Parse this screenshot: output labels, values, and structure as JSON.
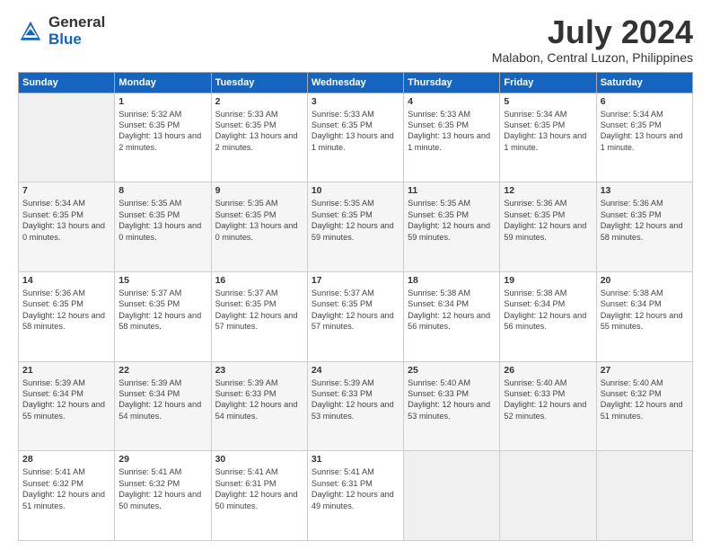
{
  "logo": {
    "text_general": "General",
    "text_blue": "Blue"
  },
  "header": {
    "title": "July 2024",
    "subtitle": "Malabon, Central Luzon, Philippines"
  },
  "days_of_week": [
    "Sunday",
    "Monday",
    "Tuesday",
    "Wednesday",
    "Thursday",
    "Friday",
    "Saturday"
  ],
  "weeks": [
    [
      {
        "day": "",
        "empty": true
      },
      {
        "day": "1",
        "sunrise": "Sunrise: 5:32 AM",
        "sunset": "Sunset: 6:35 PM",
        "daylight": "Daylight: 13 hours and 2 minutes."
      },
      {
        "day": "2",
        "sunrise": "Sunrise: 5:33 AM",
        "sunset": "Sunset: 6:35 PM",
        "daylight": "Daylight: 13 hours and 2 minutes."
      },
      {
        "day": "3",
        "sunrise": "Sunrise: 5:33 AM",
        "sunset": "Sunset: 6:35 PM",
        "daylight": "Daylight: 13 hours and 1 minute."
      },
      {
        "day": "4",
        "sunrise": "Sunrise: 5:33 AM",
        "sunset": "Sunset: 6:35 PM",
        "daylight": "Daylight: 13 hours and 1 minute."
      },
      {
        "day": "5",
        "sunrise": "Sunrise: 5:34 AM",
        "sunset": "Sunset: 6:35 PM",
        "daylight": "Daylight: 13 hours and 1 minute."
      },
      {
        "day": "6",
        "sunrise": "Sunrise: 5:34 AM",
        "sunset": "Sunset: 6:35 PM",
        "daylight": "Daylight: 13 hours and 1 minute."
      }
    ],
    [
      {
        "day": "7",
        "sunrise": "Sunrise: 5:34 AM",
        "sunset": "Sunset: 6:35 PM",
        "daylight": "Daylight: 13 hours and 0 minutes."
      },
      {
        "day": "8",
        "sunrise": "Sunrise: 5:35 AM",
        "sunset": "Sunset: 6:35 PM",
        "daylight": "Daylight: 13 hours and 0 minutes."
      },
      {
        "day": "9",
        "sunrise": "Sunrise: 5:35 AM",
        "sunset": "Sunset: 6:35 PM",
        "daylight": "Daylight: 13 hours and 0 minutes."
      },
      {
        "day": "10",
        "sunrise": "Sunrise: 5:35 AM",
        "sunset": "Sunset: 6:35 PM",
        "daylight": "Daylight: 12 hours and 59 minutes."
      },
      {
        "day": "11",
        "sunrise": "Sunrise: 5:35 AM",
        "sunset": "Sunset: 6:35 PM",
        "daylight": "Daylight: 12 hours and 59 minutes."
      },
      {
        "day": "12",
        "sunrise": "Sunrise: 5:36 AM",
        "sunset": "Sunset: 6:35 PM",
        "daylight": "Daylight: 12 hours and 59 minutes."
      },
      {
        "day": "13",
        "sunrise": "Sunrise: 5:36 AM",
        "sunset": "Sunset: 6:35 PM",
        "daylight": "Daylight: 12 hours and 58 minutes."
      }
    ],
    [
      {
        "day": "14",
        "sunrise": "Sunrise: 5:36 AM",
        "sunset": "Sunset: 6:35 PM",
        "daylight": "Daylight: 12 hours and 58 minutes."
      },
      {
        "day": "15",
        "sunrise": "Sunrise: 5:37 AM",
        "sunset": "Sunset: 6:35 PM",
        "daylight": "Daylight: 12 hours and 58 minutes."
      },
      {
        "day": "16",
        "sunrise": "Sunrise: 5:37 AM",
        "sunset": "Sunset: 6:35 PM",
        "daylight": "Daylight: 12 hours and 57 minutes."
      },
      {
        "day": "17",
        "sunrise": "Sunrise: 5:37 AM",
        "sunset": "Sunset: 6:35 PM",
        "daylight": "Daylight: 12 hours and 57 minutes."
      },
      {
        "day": "18",
        "sunrise": "Sunrise: 5:38 AM",
        "sunset": "Sunset: 6:34 PM",
        "daylight": "Daylight: 12 hours and 56 minutes."
      },
      {
        "day": "19",
        "sunrise": "Sunrise: 5:38 AM",
        "sunset": "Sunset: 6:34 PM",
        "daylight": "Daylight: 12 hours and 56 minutes."
      },
      {
        "day": "20",
        "sunrise": "Sunrise: 5:38 AM",
        "sunset": "Sunset: 6:34 PM",
        "daylight": "Daylight: 12 hours and 55 minutes."
      }
    ],
    [
      {
        "day": "21",
        "sunrise": "Sunrise: 5:39 AM",
        "sunset": "Sunset: 6:34 PM",
        "daylight": "Daylight: 12 hours and 55 minutes."
      },
      {
        "day": "22",
        "sunrise": "Sunrise: 5:39 AM",
        "sunset": "Sunset: 6:34 PM",
        "daylight": "Daylight: 12 hours and 54 minutes."
      },
      {
        "day": "23",
        "sunrise": "Sunrise: 5:39 AM",
        "sunset": "Sunset: 6:33 PM",
        "daylight": "Daylight: 12 hours and 54 minutes."
      },
      {
        "day": "24",
        "sunrise": "Sunrise: 5:39 AM",
        "sunset": "Sunset: 6:33 PM",
        "daylight": "Daylight: 12 hours and 53 minutes."
      },
      {
        "day": "25",
        "sunrise": "Sunrise: 5:40 AM",
        "sunset": "Sunset: 6:33 PM",
        "daylight": "Daylight: 12 hours and 53 minutes."
      },
      {
        "day": "26",
        "sunrise": "Sunrise: 5:40 AM",
        "sunset": "Sunset: 6:33 PM",
        "daylight": "Daylight: 12 hours and 52 minutes."
      },
      {
        "day": "27",
        "sunrise": "Sunrise: 5:40 AM",
        "sunset": "Sunset: 6:32 PM",
        "daylight": "Daylight: 12 hours and 51 minutes."
      }
    ],
    [
      {
        "day": "28",
        "sunrise": "Sunrise: 5:41 AM",
        "sunset": "Sunset: 6:32 PM",
        "daylight": "Daylight: 12 hours and 51 minutes."
      },
      {
        "day": "29",
        "sunrise": "Sunrise: 5:41 AM",
        "sunset": "Sunset: 6:32 PM",
        "daylight": "Daylight: 12 hours and 50 minutes."
      },
      {
        "day": "30",
        "sunrise": "Sunrise: 5:41 AM",
        "sunset": "Sunset: 6:31 PM",
        "daylight": "Daylight: 12 hours and 50 minutes."
      },
      {
        "day": "31",
        "sunrise": "Sunrise: 5:41 AM",
        "sunset": "Sunset: 6:31 PM",
        "daylight": "Daylight: 12 hours and 49 minutes."
      },
      {
        "day": "",
        "empty": true
      },
      {
        "day": "",
        "empty": true
      },
      {
        "day": "",
        "empty": true
      }
    ]
  ]
}
